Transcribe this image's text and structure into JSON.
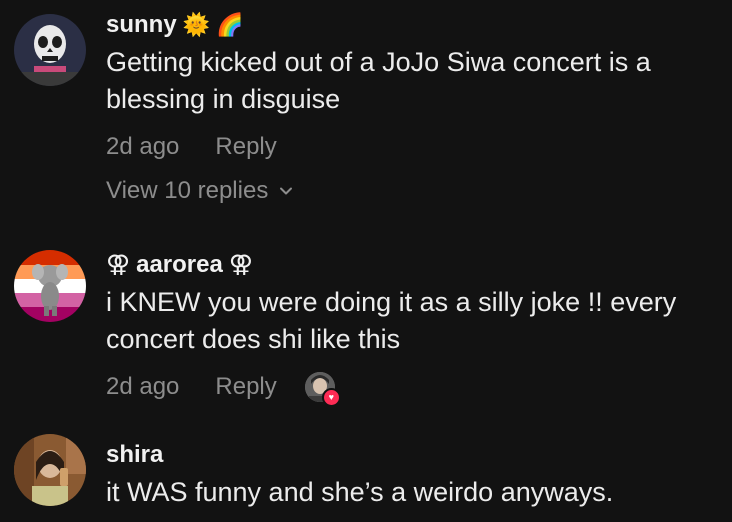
{
  "comments": [
    {
      "username": "sunny",
      "username_emojis": [
        "🌞",
        "🌈"
      ],
      "text": "Getting kicked out of a JoJo Siwa concert is a blessing in disguise",
      "time": "2d ago",
      "reply_label": "Reply",
      "view_replies_label": "View 10 replies"
    },
    {
      "username": "aarorea",
      "username_prefix": "⚢",
      "username_suffix": "⚢",
      "text": "i KNEW you were doing it as a silly joke !! every concert does shi like this",
      "time": "2d ago",
      "reply_label": "Reply"
    },
    {
      "username": "shira",
      "text": "it WAS funny and she’s a weirdo anyways."
    }
  ],
  "colors": {
    "background": "#121212",
    "primary_text": "#ececec",
    "secondary_text": "#8d8d8d",
    "like_heart": "#fe2c55"
  },
  "icons": {
    "chevron": "chevron-down-icon",
    "heart": "heart-icon"
  }
}
